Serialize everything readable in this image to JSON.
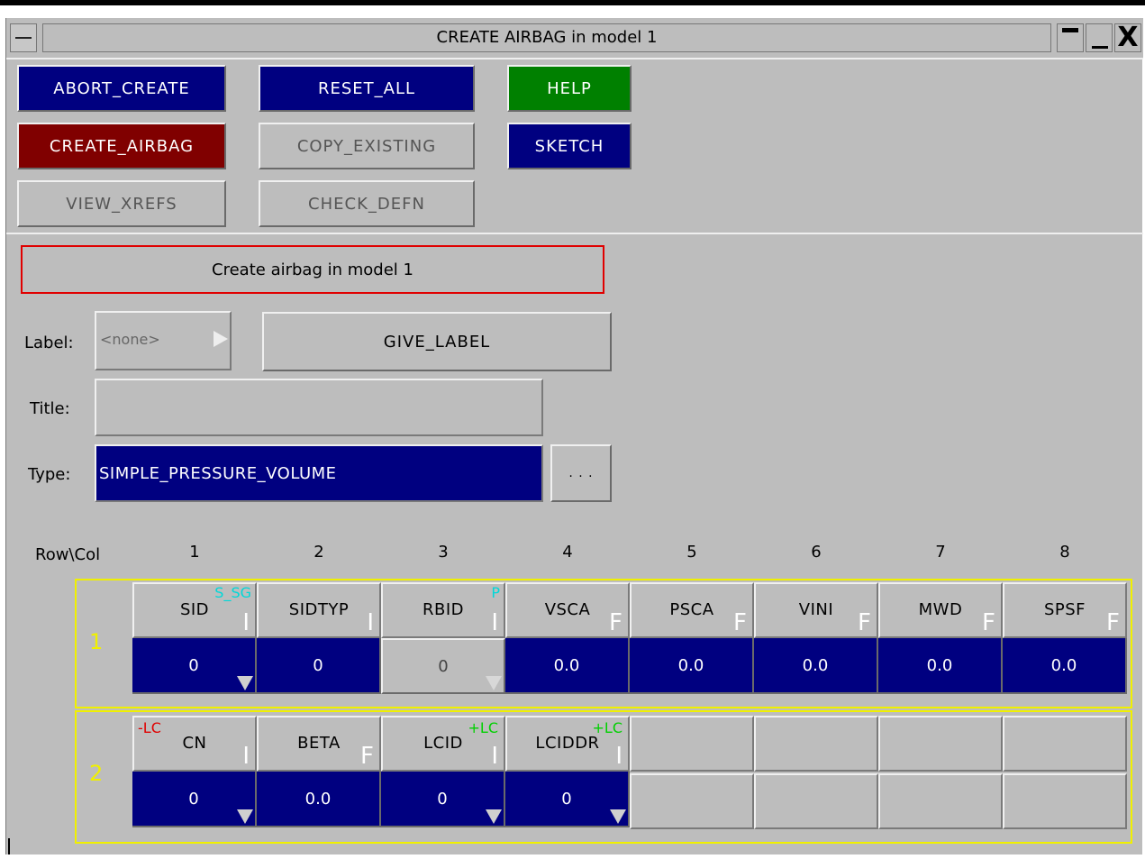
{
  "window": {
    "title": "CREATE AIRBAG in model 1",
    "close_glyph": "X"
  },
  "buttons": {
    "abort_create": "ABORT_CREATE",
    "reset_all": "RESET_ALL",
    "help": "HELP",
    "create_airbag": "CREATE_AIRBAG",
    "copy_existing": "COPY_EXISTING",
    "sketch": "SKETCH",
    "view_xrefs": "VIEW_XREFS",
    "check_defn": "CHECK_DEFN",
    "give_label": "GIVE_LABEL",
    "type_more": ". . ."
  },
  "status": {
    "message": "Create airbag in model 1"
  },
  "form": {
    "label_caption": "Label:",
    "label_value": "<none>",
    "title_caption": "Title:",
    "title_value": "",
    "type_caption": "Type:",
    "type_value": "SIMPLE_PRESSURE_VOLUME"
  },
  "grid": {
    "rowcol_label": "Row\\Col",
    "columns": [
      "1",
      "2",
      "3",
      "4",
      "5",
      "6",
      "7",
      "8"
    ],
    "rows": [
      {
        "num": "1",
        "cells": [
          {
            "name": "SID",
            "type": "I",
            "tag": "S_SG",
            "tag_color": "#00d8d8",
            "value": "0",
            "dropdown": true
          },
          {
            "name": "SIDTYP",
            "type": "I",
            "value": "0"
          },
          {
            "name": "RBID",
            "type": "I",
            "tag": "P",
            "tag_color": "#00d8d8",
            "value": "0",
            "dropdown": true,
            "disabled": true
          },
          {
            "name": "VSCA",
            "type": "F",
            "value": "0.0"
          },
          {
            "name": "PSCA",
            "type": "F",
            "value": "0.0"
          },
          {
            "name": "VINI",
            "type": "F",
            "value": "0.0"
          },
          {
            "name": "MWD",
            "type": "F",
            "value": "0.0"
          },
          {
            "name": "SPSF",
            "type": "F",
            "value": "0.0"
          }
        ]
      },
      {
        "num": "2",
        "cells": [
          {
            "name": "CN",
            "type": "I",
            "tag": "-LC",
            "tag_color": "#e00000",
            "value": "0",
            "dropdown": true
          },
          {
            "name": "BETA",
            "type": "F",
            "value": "0.0"
          },
          {
            "name": "LCID",
            "type": "I",
            "tag": "+LC",
            "tag_color": "#00d000",
            "value": "0",
            "dropdown": true
          },
          {
            "name": "LCIDDR",
            "type": "I",
            "tag": "+LC",
            "tag_color": "#00d000",
            "value": "0",
            "dropdown": true
          }
        ]
      }
    ]
  },
  "colors": {
    "background": "#bdbdbd",
    "blue_button": "#000080",
    "green_button": "#008000",
    "red_button": "#800000",
    "status_border": "#e00000",
    "row_border": "#f0f000"
  }
}
